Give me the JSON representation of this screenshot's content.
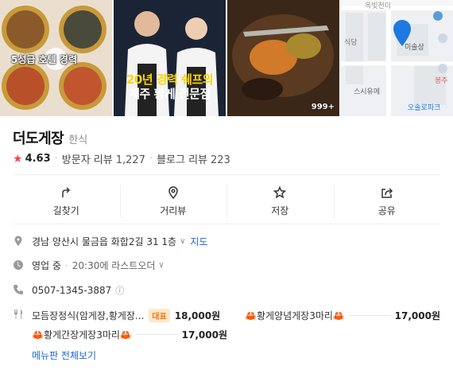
{
  "photos": {
    "p1_caption": "5성급 호텔 경력",
    "p2_caption_line1": "20년 경력 쉐프의",
    "p2_caption_line2": "제주 황게 전문점",
    "p3_count": "999+",
    "map_labels": [
      "옥빛천미",
      "식당",
      "미솔상",
      "스시유메",
      "봉주",
      "오솔로파크"
    ]
  },
  "restaurant": {
    "name": "더도게장",
    "category": "한식",
    "rating": "4.63",
    "visitor_review_label": "방문자 리뷰",
    "visitor_review_count": "1,227",
    "blog_review_label": "블로그 리뷰",
    "blog_review_count": "223"
  },
  "actions": [
    {
      "label": "길찾기",
      "icon": "directions-icon"
    },
    {
      "label": "거리뷰",
      "icon": "map-pin-icon"
    },
    {
      "label": "저장",
      "icon": "star-icon"
    },
    {
      "label": "공유",
      "icon": "share-icon"
    }
  ],
  "info": {
    "address": "경남 양산시 물금읍 화합2길 31 1층",
    "map_link": "지도",
    "status": "영업 중",
    "status_detail": "20:30에 라스트오더",
    "phone": "0507-1345-3887"
  },
  "menu": {
    "items": [
      {
        "name": "모듬장정식(암게장,황게장...",
        "tag": "대표",
        "price": "18,000원"
      },
      {
        "name": "황게양념게장3마리",
        "price": "17,000원"
      },
      {
        "name": "황게간장게장3마리",
        "price": "17,000원"
      }
    ],
    "view_all": "메뉴판 전체보기"
  },
  "colors": {
    "accent_blue": "#1a66d9",
    "star_red": "#f24a4a",
    "tag_orange": "#e87c1b"
  }
}
